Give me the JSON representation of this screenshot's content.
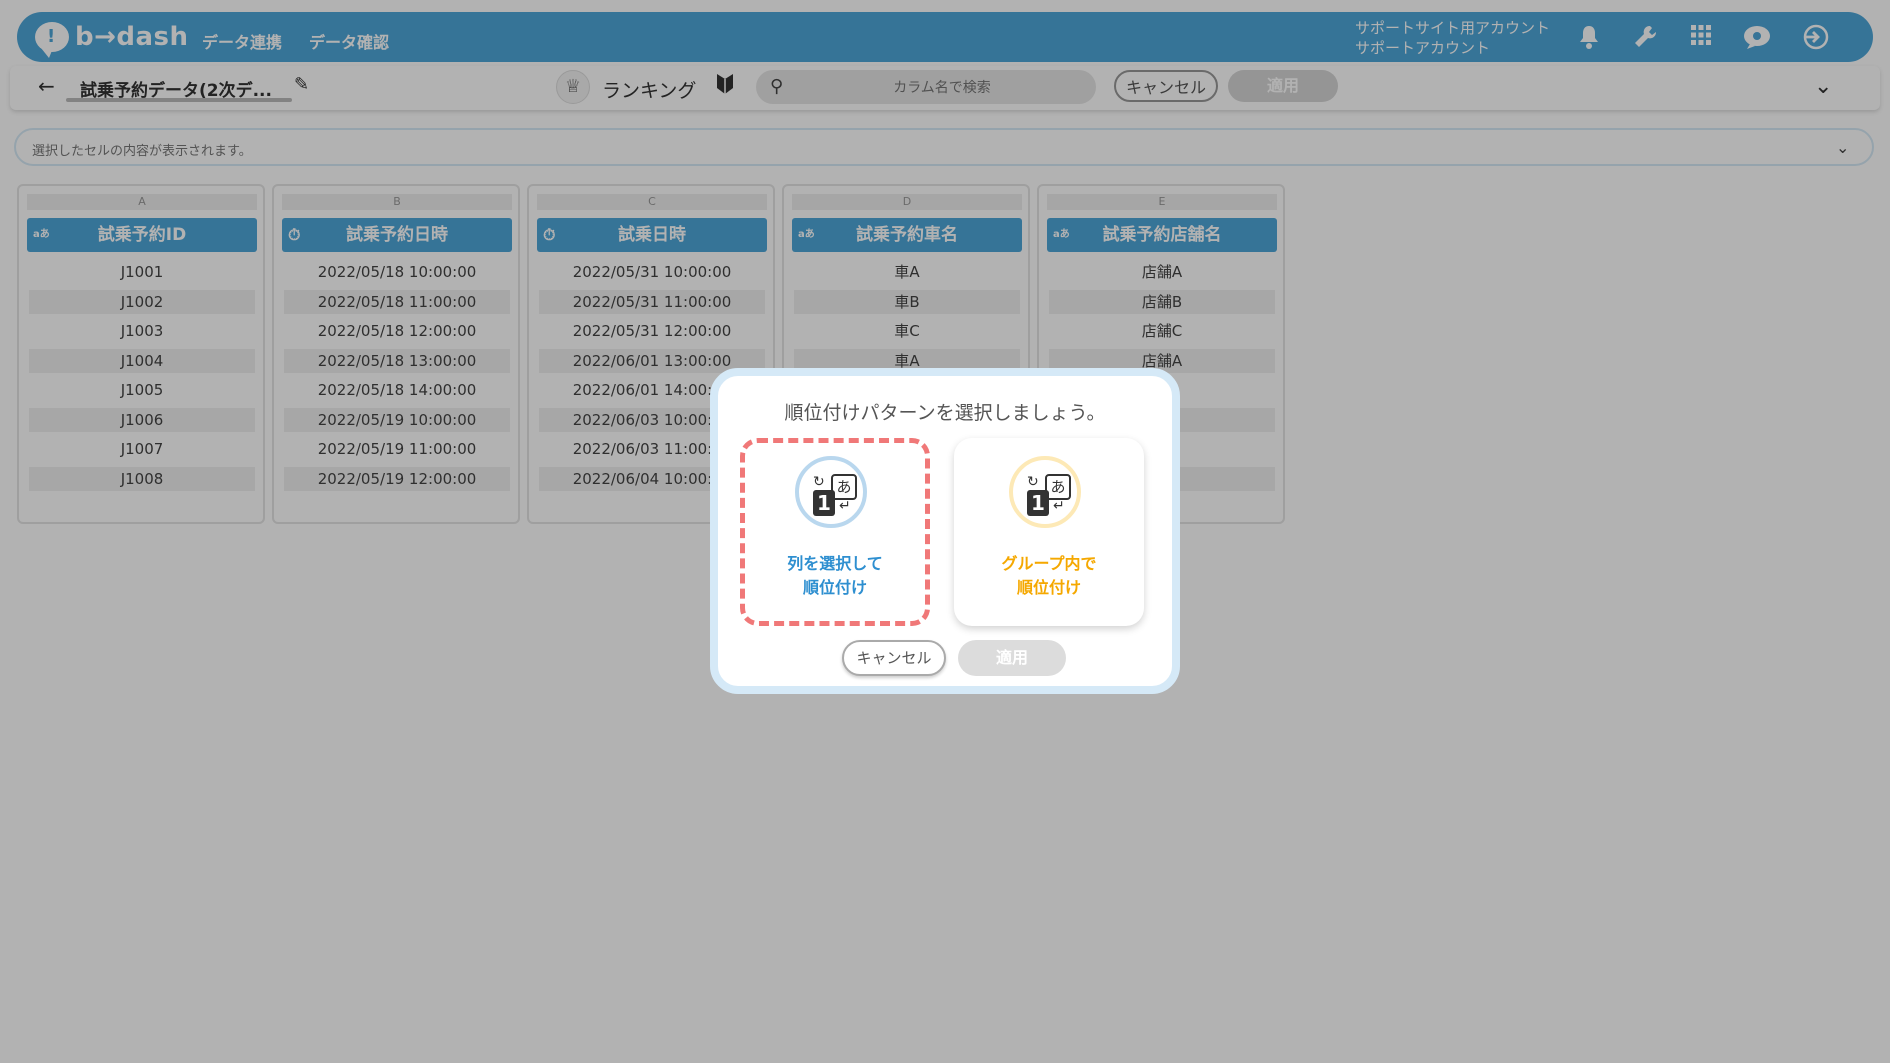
{
  "app": {
    "logo_text": "b→dash",
    "nav": [
      "データ連携",
      "データ確認"
    ],
    "account_line1": "サポートサイト用アカウント",
    "account_line2": "サポートアカウント",
    "accent_color": "#4ea6d8"
  },
  "toolbar": {
    "dataset_title": "試乗予約データ(2次デ...",
    "rank_label": "ランキング",
    "search_placeholder": "カラム名で検索",
    "cancel_label": "キャンセル",
    "apply_label": "適用"
  },
  "cellbar": {
    "text": "選択したセルの内容が表示されます。"
  },
  "columns": [
    {
      "letter": "A",
      "type": "aあ",
      "header": "試乗予約ID",
      "cells": [
        "J1001",
        "J1002",
        "J1003",
        "J1004",
        "J1005",
        "J1006",
        "J1007",
        "J1008"
      ]
    },
    {
      "letter": "B",
      "type": "⏱",
      "header": "試乗予約日時",
      "cells": [
        "2022/05/18 10:00:00",
        "2022/05/18 11:00:00",
        "2022/05/18 12:00:00",
        "2022/05/18 13:00:00",
        "2022/05/18 14:00:00",
        "2022/05/19 10:00:00",
        "2022/05/19 11:00:00",
        "2022/05/19 12:00:00"
      ]
    },
    {
      "letter": "C",
      "type": "⏱",
      "header": "試乗日時",
      "cells": [
        "2022/05/31 10:00:00",
        "2022/05/31 11:00:00",
        "2022/05/31 12:00:00",
        "2022/06/01 13:00:00",
        "2022/06/01 14:00:00",
        "2022/06/03 10:00:00",
        "2022/06/03 11:00:00",
        "2022/06/04 10:00:00"
      ]
    },
    {
      "letter": "D",
      "type": "aあ",
      "header": "試乗予約車名",
      "cells": [
        "車A",
        "車B",
        "車C",
        "車A",
        "",
        "",
        "",
        ""
      ]
    },
    {
      "letter": "E",
      "type": "aあ",
      "header": "試乗予約店舗名",
      "cells": [
        "店舗A",
        "店舗B",
        "店舗C",
        "店舗A",
        "",
        "",
        "",
        ""
      ]
    }
  ],
  "modal": {
    "title": "順位付けパターンを選択しましょう。",
    "options": [
      {
        "line1": "列を選択して",
        "line2": "順位付け",
        "color": "#2e8fd0",
        "ring": "#b9d7ee",
        "selected": true
      },
      {
        "line1": "グループ内で",
        "line2": "順位付け",
        "color": "#f5a800",
        "ring": "#fde9b6",
        "selected": false
      }
    ],
    "cancel_label": "キャンセル",
    "apply_label": "適用"
  }
}
